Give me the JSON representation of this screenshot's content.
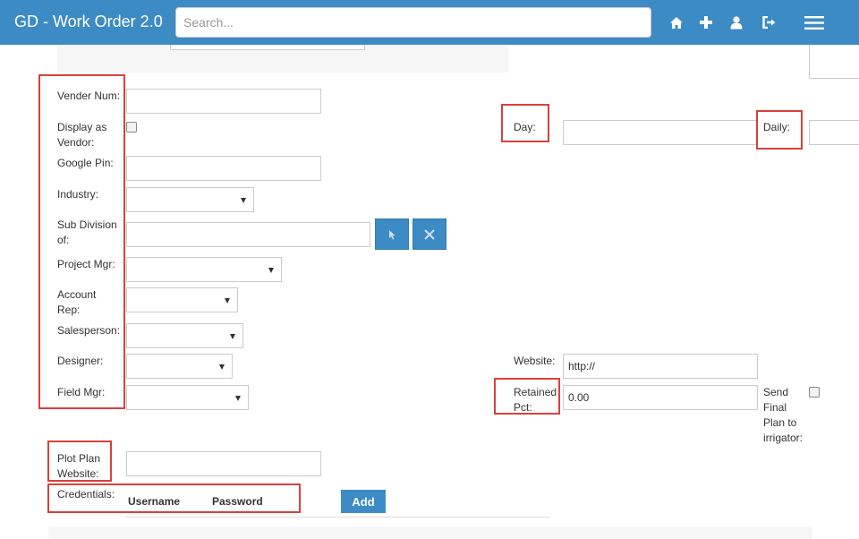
{
  "app": {
    "title": "GD - Work Order 2.0"
  },
  "search": {
    "placeholder": "Search..."
  },
  "nav_icons": [
    "home-icon",
    "plus-icon",
    "user-icon",
    "sign-out-icon",
    "hamburger-menu-icon"
  ],
  "form": {
    "vender_num_label": "Vender Num:",
    "display_as_vendor_label": "Display as Vendor:",
    "google_pin_label": "Google Pin:",
    "industry_label": "Industry:",
    "sub_division_label": "Sub Division of:",
    "project_mgr_label": "Project Mgr:",
    "account_rep_label": "Account Rep:",
    "salesperson_label": "Salesperson:",
    "designer_label": "Designer:",
    "field_mgr_label": "Field Mgr:",
    "day_label": "Day:",
    "daily_label": "Daily:",
    "website_label": "Website:",
    "website_value": "http://",
    "retained_pct_label": "Retained Pct:",
    "retained_pct_value": "0.00",
    "send_final_plan_label": "Send Final Plan to irrigator:",
    "plot_plan_website_label": "Plot Plan Website:",
    "credentials_label": "Credentials:"
  },
  "credentials": {
    "username_header": "Username",
    "password_header": "Password",
    "add_label": "Add"
  },
  "colors": {
    "navbar": "#3d8bc4",
    "highlight_box": "#d9413b"
  }
}
